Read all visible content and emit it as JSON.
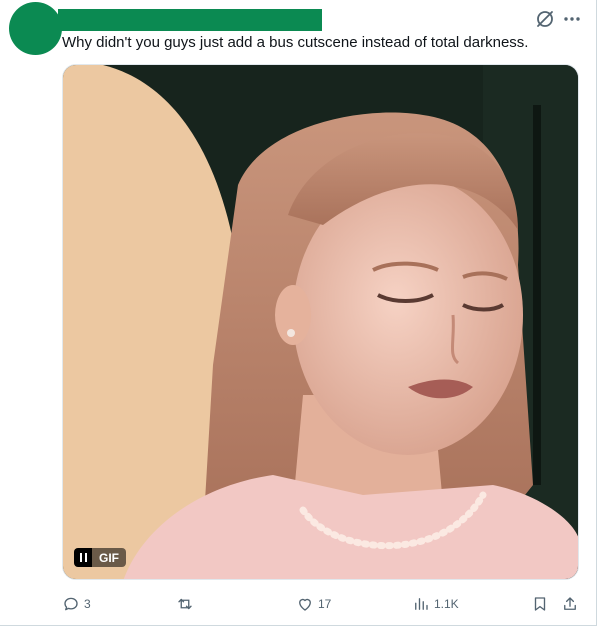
{
  "tweet": {
    "text": "Why didn't you guys just add a bus cutscene instead of total darkness."
  },
  "header": {
    "grok_icon": "grok-slash-circle-icon",
    "more_icon": "more-dots-icon"
  },
  "media": {
    "type": "gif",
    "gif_label": "GIF",
    "pause_icon": "pause-icon"
  },
  "actions": {
    "replies": "3",
    "reposts": "",
    "likes": "17",
    "views": "1.1K"
  },
  "colors": {
    "redaction": "#0b8a52",
    "icon_gray": "#536471",
    "text": "#0f1419"
  }
}
